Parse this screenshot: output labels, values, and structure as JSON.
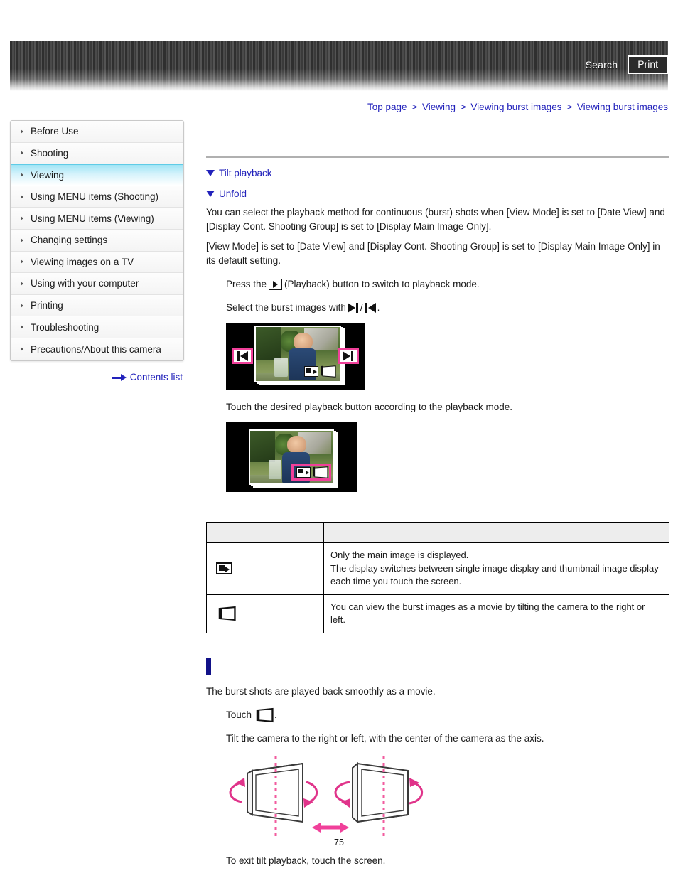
{
  "header": {
    "search_label": "Search",
    "print_label": "Print",
    "search_icon": "search-icon",
    "print_icon": "print-icon"
  },
  "breadcrumb": {
    "items": [
      "Top page",
      "Viewing",
      "Viewing burst images",
      "Viewing burst images"
    ],
    "separator": ">"
  },
  "sidebar": {
    "items": [
      {
        "label": "Before Use",
        "active": false
      },
      {
        "label": "Shooting",
        "active": false
      },
      {
        "label": "Viewing",
        "active": true
      },
      {
        "label": "Using MENU items (Shooting)",
        "active": false
      },
      {
        "label": "Using MENU items (Viewing)",
        "active": false
      },
      {
        "label": "Changing settings",
        "active": false
      },
      {
        "label": "Viewing images on a TV",
        "active": false
      },
      {
        "label": "Using with your computer",
        "active": false
      },
      {
        "label": "Printing",
        "active": false
      },
      {
        "label": "Troubleshooting",
        "active": false
      },
      {
        "label": "Precautions/About this camera",
        "active": false
      }
    ],
    "contents_link": "Contents list",
    "highlight_color": "#9fe4f5"
  },
  "main": {
    "toggles": [
      {
        "label": "Tilt playback"
      },
      {
        "label": "Unfold"
      }
    ],
    "paragraph_1": "You can select the playback method for continuous (burst) shots when [View Mode] is set to [Date View] and [Display Cont. Shooting Group] is set to [Display Main Image Only].",
    "paragraph_2": "[View Mode] is set to [Date View] and [Display Cont. Shooting Group] is set to [Display Main Image Only] in its default setting.",
    "step_1_before": "Press the",
    "step_1_after": "(Playback) button to switch to playback mode.",
    "step_2_before": "Select the burst images with",
    "step_2_mid": "/",
    "step_2_after": ".",
    "step_3": "Touch the desired playback button according to the playback mode.",
    "table": {
      "headers": [
        "",
        ""
      ],
      "rows": [
        {
          "icon": "single-image-display-icon",
          "text": "Only the main image is displayed.\nThe display switches between single image display and thumbnail image display each time you touch the screen."
        },
        {
          "icon": "tilt-playback-icon",
          "text": "You can view the burst images as a movie by tilting the camera to the right or left."
        }
      ]
    },
    "section_heading": "",
    "section_intro": "The burst shots are played back smoothly as a movie.",
    "tilt_step_1_before": "Touch",
    "tilt_step_1_after": ".",
    "tilt_step_2": "Tilt the camera to the right or left, with the center of the camera as the axis.",
    "tilt_exit": "To exit tilt playback, touch the screen."
  },
  "colors": {
    "link": "#2222bb",
    "accent_pink": "#f0409a",
    "section_marker": "#111188",
    "table_header_bg": "#ededed"
  },
  "page_number": "75"
}
